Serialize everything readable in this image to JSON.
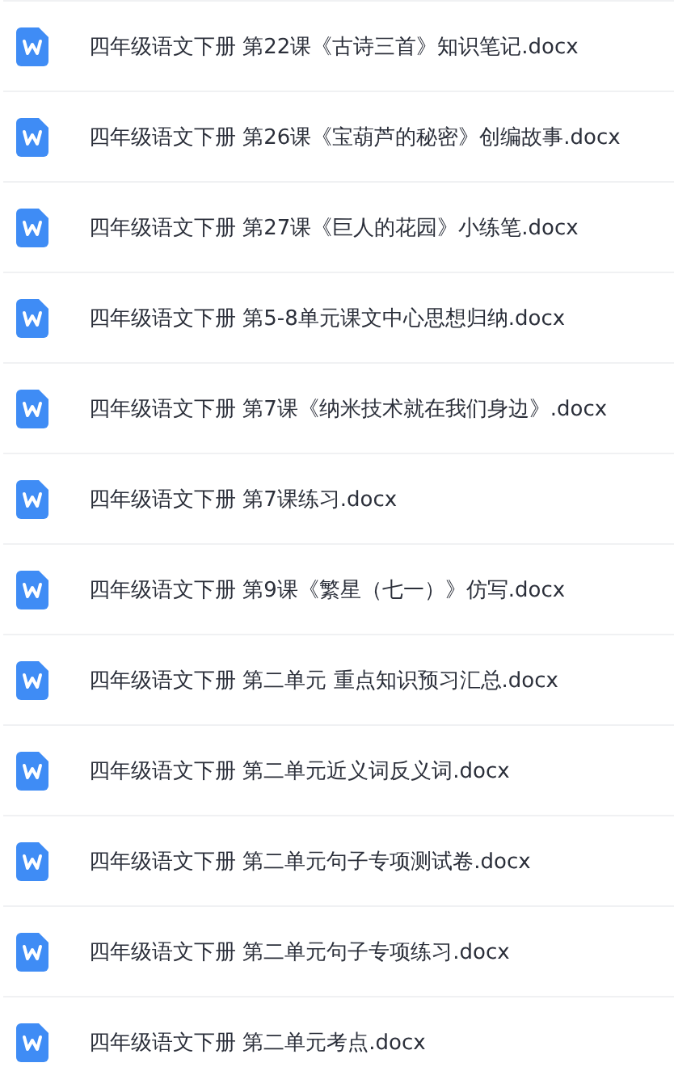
{
  "files": [
    {
      "name": "四年级语文下册 第22课《古诗三首》知识笔记.docx"
    },
    {
      "name": "四年级语文下册 第26课《宝葫芦的秘密》创编故事.docx"
    },
    {
      "name": "四年级语文下册 第27课《巨人的花园》小练笔.docx"
    },
    {
      "name": "四年级语文下册 第5-8单元课文中心思想归纳.docx"
    },
    {
      "name": "四年级语文下册 第7课《纳米技术就在我们身边》.docx"
    },
    {
      "name": "四年级语文下册 第7课练习.docx"
    },
    {
      "name": "四年级语文下册 第9课《繁星（七一）》仿写.docx"
    },
    {
      "name": "四年级语文下册 第二单元 重点知识预习汇总.docx"
    },
    {
      "name": "四年级语文下册 第二单元近义词反义词.docx"
    },
    {
      "name": "四年级语文下册 第二单元句子专项测试卷.docx"
    },
    {
      "name": "四年级语文下册 第二单元句子专项练习.docx"
    },
    {
      "name": "四年级语文下册 第二单元考点.docx"
    }
  ]
}
